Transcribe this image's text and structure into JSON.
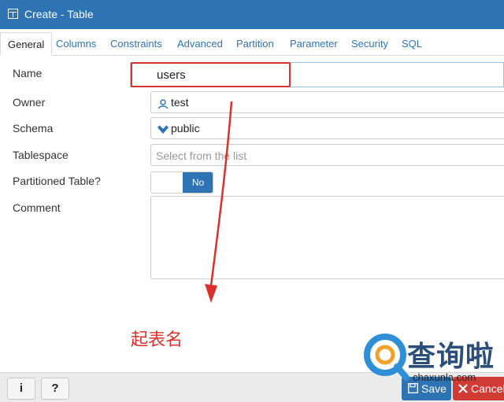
{
  "window": {
    "title": "Create - Table"
  },
  "tabs": [
    {
      "label": "General"
    },
    {
      "label": "Columns"
    },
    {
      "label": "Constraints"
    },
    {
      "label": "Advanced"
    },
    {
      "label": "Partition"
    },
    {
      "label": "Parameter"
    },
    {
      "label": "Security"
    },
    {
      "label": "SQL"
    }
  ],
  "form": {
    "name_label": "Name",
    "name_value": "users",
    "owner_label": "Owner",
    "owner_value": "test",
    "schema_label": "Schema",
    "schema_value": "public",
    "tablespace_label": "Tablespace",
    "tablespace_placeholder": "Select from the list",
    "partitioned_label": "Partitioned Table?",
    "partitioned_value": "No",
    "comment_label": "Comment"
  },
  "annotation": {
    "text": "起表名"
  },
  "footer": {
    "info_label": "i",
    "help_label": "?",
    "save_label": "Save",
    "cancel_label": "Cancel"
  },
  "watermark": {
    "title": "查询啦",
    "site": "chaxunla.com"
  },
  "colors": {
    "accent": "#2e74b5",
    "annotation_red": "#d9312b",
    "cancel_red": "#d03b36"
  }
}
